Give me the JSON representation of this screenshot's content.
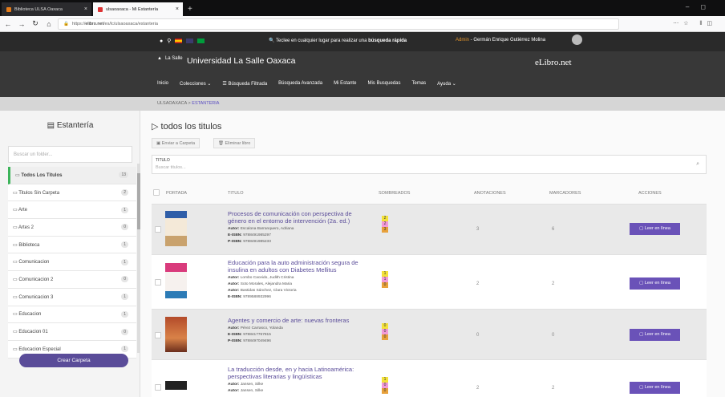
{
  "browser": {
    "tabs": [
      {
        "label": "Biblioteca ULSA Oaxaca"
      },
      {
        "label": "ulsaoaxaca - Mi Estantería"
      }
    ],
    "url_prefix": "https://",
    "url_domain": "elibro.net",
    "url_path": "/es/lc/ulsaoaxaca/estanteria"
  },
  "header": {
    "search_hint_pre": "Teclee en cualquier lugar para realizar una ",
    "search_hint_bold": "búsqueda rápida",
    "admin_label": "Admin",
    "admin_name": " - Germán Enrique Gutiérrez Molina",
    "logo_text": "La Salle",
    "university": "Universidad La Salle Oaxaca",
    "brand": "eLibro.net",
    "menu": [
      "Inicio",
      "Colecciones ⌄",
      "☰ Búsqueda Filtrada",
      "Búsqueda Avanzada",
      "Mi Estante",
      "Mis Busquedas",
      "Temas",
      "Ayuda ⌄"
    ]
  },
  "breadcrumb": {
    "root": "ULSAOAXACA",
    "sep": " > ",
    "current": "ESTANTERIA"
  },
  "sidebar": {
    "title": "Estantería",
    "folder_placeholder": "Buscar un folder...",
    "create_label": "Crear Carpeta",
    "items": [
      {
        "label": "Todos Los Titulos",
        "count": "13"
      },
      {
        "label": "Titulos Sin Carpeta",
        "count": "2"
      },
      {
        "label": "Arte",
        "count": "1"
      },
      {
        "label": "Artes 2",
        "count": "0"
      },
      {
        "label": "Biblioteca",
        "count": "1"
      },
      {
        "label": "Comunicacion",
        "count": "1"
      },
      {
        "label": "Comunicacion 2",
        "count": "0"
      },
      {
        "label": "Comunicacion 3",
        "count": "1"
      },
      {
        "label": "Educacion",
        "count": "1"
      },
      {
        "label": "Educacion 01",
        "count": "0"
      },
      {
        "label": "Educacion Especial",
        "count": "1"
      }
    ]
  },
  "main": {
    "title": "todos los titulos",
    "send_label": "Enviar a Carpeta",
    "delete_label": "Eliminar libro",
    "filter_label": "TITULO",
    "filter_placeholder": "Buscar titulos...",
    "columns": [
      "PORTADA",
      "TITULO",
      "SOMBREADOS",
      "ANOTACIONES",
      "MARCADORES",
      "ACCIONES"
    ],
    "read_label": "Leer en línea",
    "books": [
      {
        "title": "Procesos de comunicación con perspectiva de género en el entorno de intervención (2a. ed.)",
        "author_label": "Autor:",
        "author": "Escalona Barranquero, Adriana",
        "eisbn_label": "E-ISBN:",
        "eisbn": "9788491985297",
        "pisbn_label": "P-ISBN:",
        "pisbn": "9788491985233",
        "hl": [
          "2",
          "2",
          "3"
        ],
        "annotations": "3",
        "bookmarks": "6"
      },
      {
        "title": "Educación para la auto administración segura de insulina en adultos con Diabetes Mellitus",
        "author_label": "Autor:",
        "author": "Lombo Caceido, Judith Cristina",
        "author2": "Soto Morales, Alejandra Maria",
        "author3": "Bastidas Sánchez, Clara Victoria",
        "eisbn_label": "E-ISBN:",
        "eisbn": "9789588932996",
        "hl": [
          "1",
          "1",
          "0"
        ],
        "annotations": "2",
        "bookmarks": "2"
      },
      {
        "title": "Agentes y comercio de arte: nuevas fronteras",
        "author_label": "Autor:",
        "author": "Pérez Carrasco, Yolanda",
        "eisbn_label": "E-ISBN:",
        "eisbn": "9788417767815",
        "pisbn_label": "P-ISBN:",
        "pisbn": "9788497049496",
        "hl": [
          "0",
          "0",
          "0"
        ],
        "annotations": "0",
        "bookmarks": "0"
      },
      {
        "title": "La traducción desde, en y hacia Latinoamérica: perspectivas literarias y lingüísticas",
        "author_label": "Autor:",
        "author": "Jansen, Silke",
        "author2": "Jansen, Silke",
        "hl": [
          "1",
          "0",
          "0"
        ],
        "annotations": "2",
        "bookmarks": "2"
      }
    ]
  },
  "colors": {
    "accent": "#6a52b8",
    "active_folder": "#3cb45a",
    "hl_yellow": "#f3e23a",
    "hl_pink": "#f39ad8",
    "hl_orange": "#e8a13b"
  }
}
